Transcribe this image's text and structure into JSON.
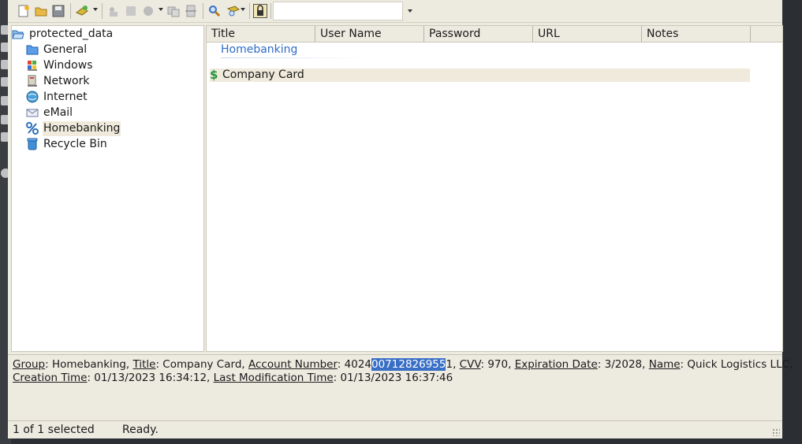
{
  "toolbar": {
    "icons": [
      "new-database-icon",
      "open-database-icon",
      "save-database-icon",
      "add-entry-icon",
      "edit-entry-icon",
      "view-entry-icon",
      "delete-entry-icon",
      "copy-username-icon",
      "copy-password-icon",
      "find-icon",
      "search-options-icon",
      "lock-icon"
    ],
    "quickfind_value": ""
  },
  "tree": {
    "root": "protected_data",
    "groups": [
      "General",
      "Windows",
      "Network",
      "Internet",
      "eMail",
      "Homebanking",
      "Recycle Bin"
    ],
    "selected": "Homebanking"
  },
  "list": {
    "columns": [
      "Title",
      "User Name",
      "Password",
      "URL",
      "Notes"
    ],
    "group_label": "Homebanking",
    "entries": [
      {
        "title": "Company Card",
        "icon": "dollar-icon"
      }
    ]
  },
  "details": {
    "group_label": "Group",
    "group_value": "Homebanking",
    "title_label": "Title",
    "title_value": "Company Card",
    "account_label": "Account Number",
    "account_prefix": "4024",
    "account_selected": "00712826955",
    "account_suffix": "1",
    "cvv_label": "CVV",
    "cvv_value": "970",
    "exp_label": "Expiration Date",
    "exp_value": "3/2028",
    "name_label": "Name",
    "name_value": "Quick Logistics LLC,",
    "created_label": "Creation Time",
    "created_value": "01/13/2023 16:34:12",
    "modified_label": "Last Modification Time",
    "modified_value": "01/13/2023 16:37:46"
  },
  "status": {
    "count": "1 of 1 selected",
    "state": "Ready."
  },
  "colors": {
    "window_bg": "#edeae0",
    "selection": "#3a6fc6",
    "group_header": "#2e6cc6",
    "row_highlight": "#efeadb"
  }
}
